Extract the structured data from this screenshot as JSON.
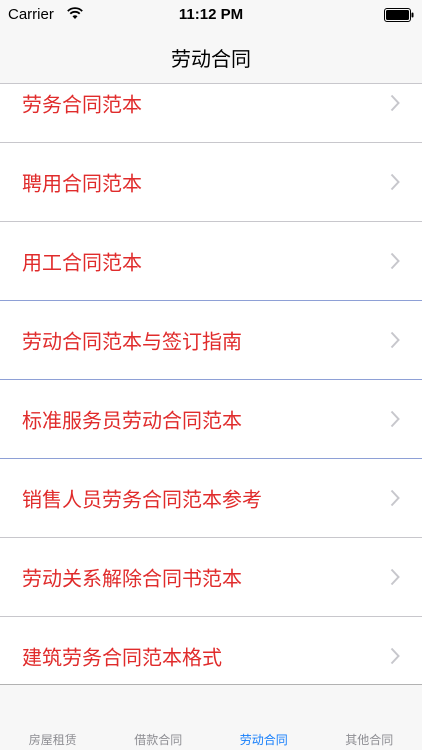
{
  "status": {
    "carrier": "Carrier",
    "time": "11:12 PM"
  },
  "nav": {
    "title": "劳动合同"
  },
  "list": {
    "items": [
      {
        "label": "劳务合同范本"
      },
      {
        "label": "聘用合同范本"
      },
      {
        "label": "用工合同范本"
      },
      {
        "label": "劳动合同范本与签订指南"
      },
      {
        "label": "标准服务员劳动合同范本"
      },
      {
        "label": "销售人员劳务合同范本参考"
      },
      {
        "label": "劳动关系解除合同书范本"
      },
      {
        "label": "建筑劳务合同范本格式"
      }
    ]
  },
  "tabs": [
    {
      "label": "房屋租赁"
    },
    {
      "label": "借款合同"
    },
    {
      "label": "劳动合同",
      "active": true
    },
    {
      "label": "其他合同"
    }
  ],
  "colors": {
    "item_text": "#e02b2b",
    "tab_active": "#157efb",
    "tab_inactive": "#8e8e93"
  }
}
